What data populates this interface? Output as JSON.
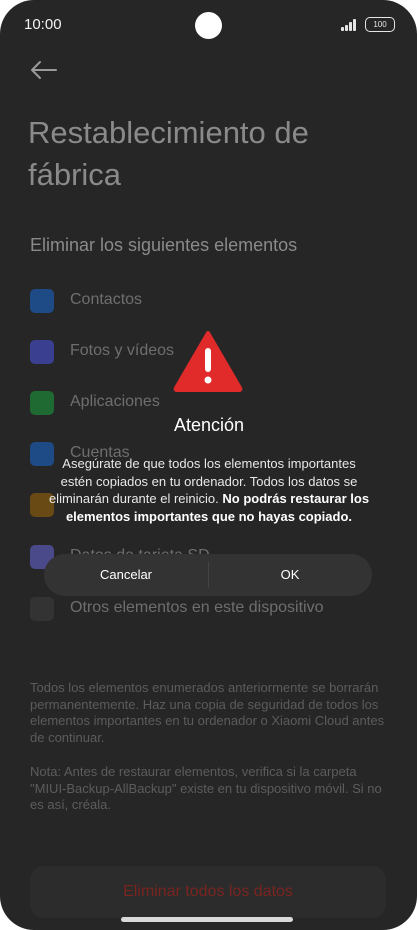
{
  "status_bar": {
    "time": "10:00",
    "battery": "100"
  },
  "page": {
    "title": "Restablecimiento de fábrica",
    "section_header": "Eliminar los siguientes elementos",
    "items": [
      {
        "label": "Contactos",
        "icon": "contacts-icon",
        "color": "#1e4a86"
      },
      {
        "label": "Fotos y vídeos",
        "icon": "photos-icon",
        "color": "#3b3f8f"
      },
      {
        "label": "Aplicaciones",
        "icon": "apps-icon",
        "color": "#1f6a33"
      },
      {
        "label": "Cuentas",
        "icon": "accounts-icon",
        "color": "#1e4a86"
      },
      {
        "label": "",
        "icon": "folder-icon",
        "color": "#6a4a14"
      },
      {
        "label": "Datos de tarjeta SD",
        "icon": "sd-card-icon",
        "color": "#4a4a8a"
      },
      {
        "label": "Otros elementos en este dispositivo",
        "icon": "device-icon",
        "color": "#333333"
      }
    ],
    "footer_note_1": "Todos los elementos enumerados anteriormente se borrarán permanentemente. Haz una copia de seguridad de todos los elementos importantes en tu ordenador o Xiaomi Cloud antes de continuar.",
    "footer_note_2": "Nota: Antes de restaurar elementos, verifica si la carpeta \"MIUI-Backup-AllBackup\" existe en tu dispositivo móvil. Si no es así, créala.",
    "delete_button": "Eliminar todos los datos"
  },
  "dialog": {
    "title": "Atención",
    "body_plain": "Asegúrate de que todos los elementos importantes estén copiados en tu ordenador. Todos los datos se eliminarán durante el reinicio. ",
    "body_bold": "No podrás restaurar los elementos importantes que no hayas copiado.",
    "cancel_label": "Cancelar",
    "ok_label": "OK",
    "warning_color": "#e12b2b"
  }
}
